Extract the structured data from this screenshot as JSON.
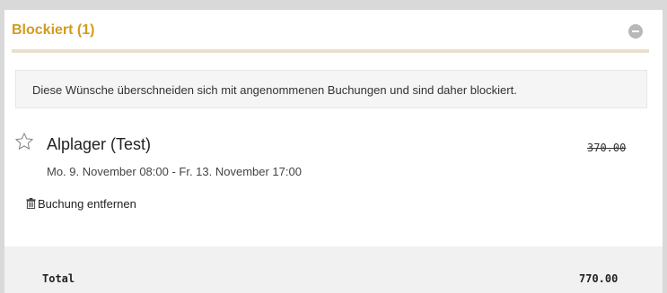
{
  "section": {
    "title": "Blockiert (1)",
    "accent_color": "#d39b1e",
    "collapse_icon": "minus-circle-icon"
  },
  "notice": {
    "text": "Diese Wünsche überschneiden sich mit angenommenen Buchungen und sind daher blockiert."
  },
  "item": {
    "icon": "star-outline-icon",
    "title": "Alplager (Test)",
    "date_range": "Mo. 9. November 08:00 - Fr. 13. November 17:00",
    "price": "370.00",
    "price_struck": true,
    "remove_icon": "trash-icon",
    "remove_label": "Buchung entfernen"
  },
  "total": {
    "label": "Total",
    "value": "770.00"
  }
}
